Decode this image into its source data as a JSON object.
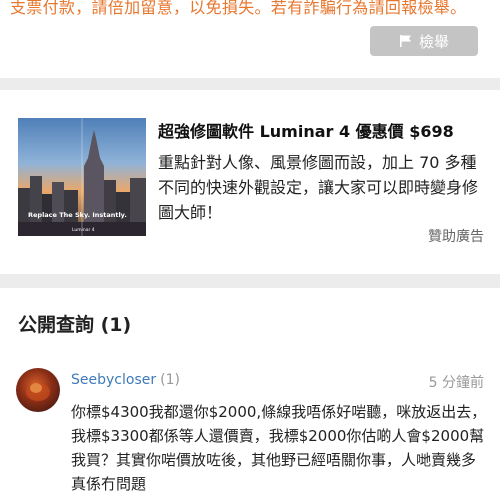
{
  "warning": {
    "text": "支票付款，請倍加留意，以免損失。若有詐騙行為請回報檢舉。",
    "report_label": "檢舉"
  },
  "ad": {
    "title": "超強修圖軟件 Luminar 4 優惠價 $698",
    "description": "重點針對人像、風景修圖而設，加上 70 多種不同的快速外觀設定，讓大家可以即時變身修圖大師！",
    "sponsor": "贊助廣告",
    "image_tagline": "Replace The Sky. Instantly.",
    "image_brand": "Luminar 4"
  },
  "enquiries": {
    "heading": "公開查詢 (1)",
    "items": [
      {
        "user": "Seebycloser",
        "count": "(1)",
        "time": "5 分鐘前",
        "body": "你標$4300我都還你$2000,條線我唔係好啱聽，咪放返出去，我標$3300都係等人還價賣，我標$2000你估啲人會$2000幫我買？其實你啱價放咗後，其他野已經唔關你事，人哋賣幾多真係冇問題"
      }
    ]
  },
  "colors": {
    "warning": "#e8772e",
    "button_bg": "#c4c4c4",
    "username": "#3e7ab8",
    "muted": "#999999",
    "page_bg": "#ececec"
  }
}
